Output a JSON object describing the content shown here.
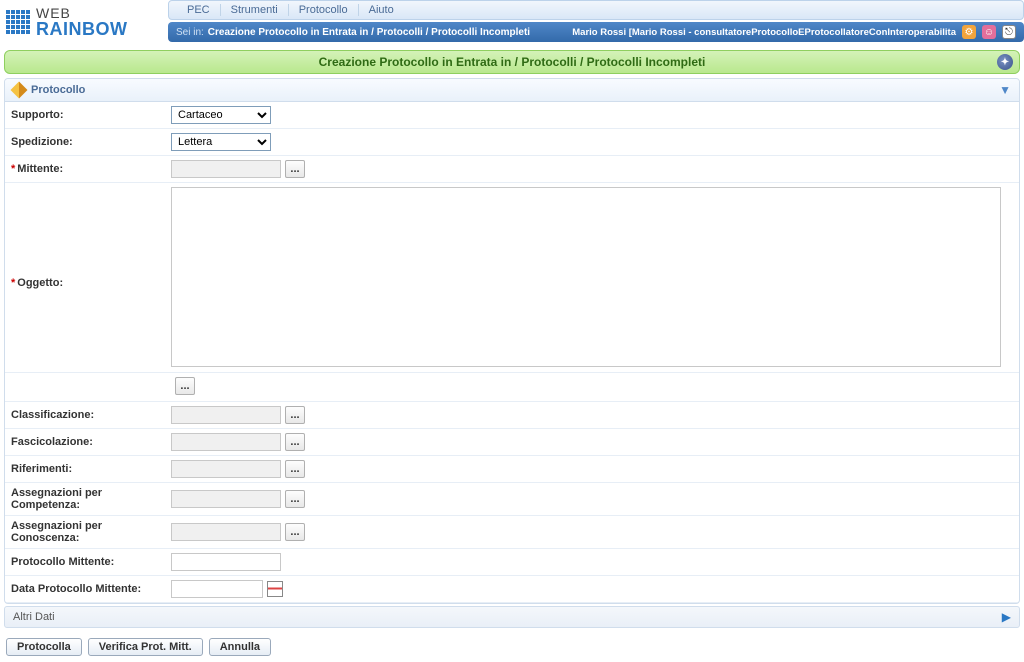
{
  "logo": {
    "line1": "WEB",
    "line2": "RAINBOW"
  },
  "menu": [
    "PEC",
    "Strumenti",
    "Protocollo",
    "Aiuto"
  ],
  "breadcrumb": {
    "label": "Sei in:",
    "path": "Creazione Protocollo in Entrata in / Protocolli / Protocolli Incompleti"
  },
  "user": "Mario Rossi [Mario Rossi - consultatoreProtocolloEProtocollatoreConInteroperabilita",
  "page_title": "Creazione Protocollo in Entrata in / Protocolli / Protocolli Incompleti",
  "section": {
    "title": "Protocollo"
  },
  "form": {
    "supporto_label": "Supporto:",
    "supporto_value": "Cartaceo",
    "spedizione_label": "Spedizione:",
    "spedizione_value": "Lettera",
    "mittente_label": "Mittente:",
    "mittente_value": "",
    "oggetto_label": "Oggetto:",
    "oggetto_value": "",
    "classificazione_label": "Classificazione:",
    "classificazione_value": "",
    "fascicolazione_label": "Fascicolazione:",
    "fascicolazione_value": "",
    "riferimenti_label": "Riferimenti:",
    "riferimenti_value": "",
    "ass_competenza_label": "Assegnazioni per Competenza:",
    "ass_competenza_value": "",
    "ass_conoscenza_label": "Assegnazioni per Conoscenza:",
    "ass_conoscenza_value": "",
    "protocollo_mittente_label": "Protocollo Mittente:",
    "protocollo_mittente_value": "",
    "data_protocollo_mittente_label": "Data Protocollo Mittente:",
    "data_protocollo_mittente_value": "",
    "browse": "..."
  },
  "subsection": {
    "title": "Altri Dati"
  },
  "actions": {
    "protocolla": "Protocolla",
    "verifica": "Verifica Prot. Mitt.",
    "annulla": "Annulla"
  }
}
